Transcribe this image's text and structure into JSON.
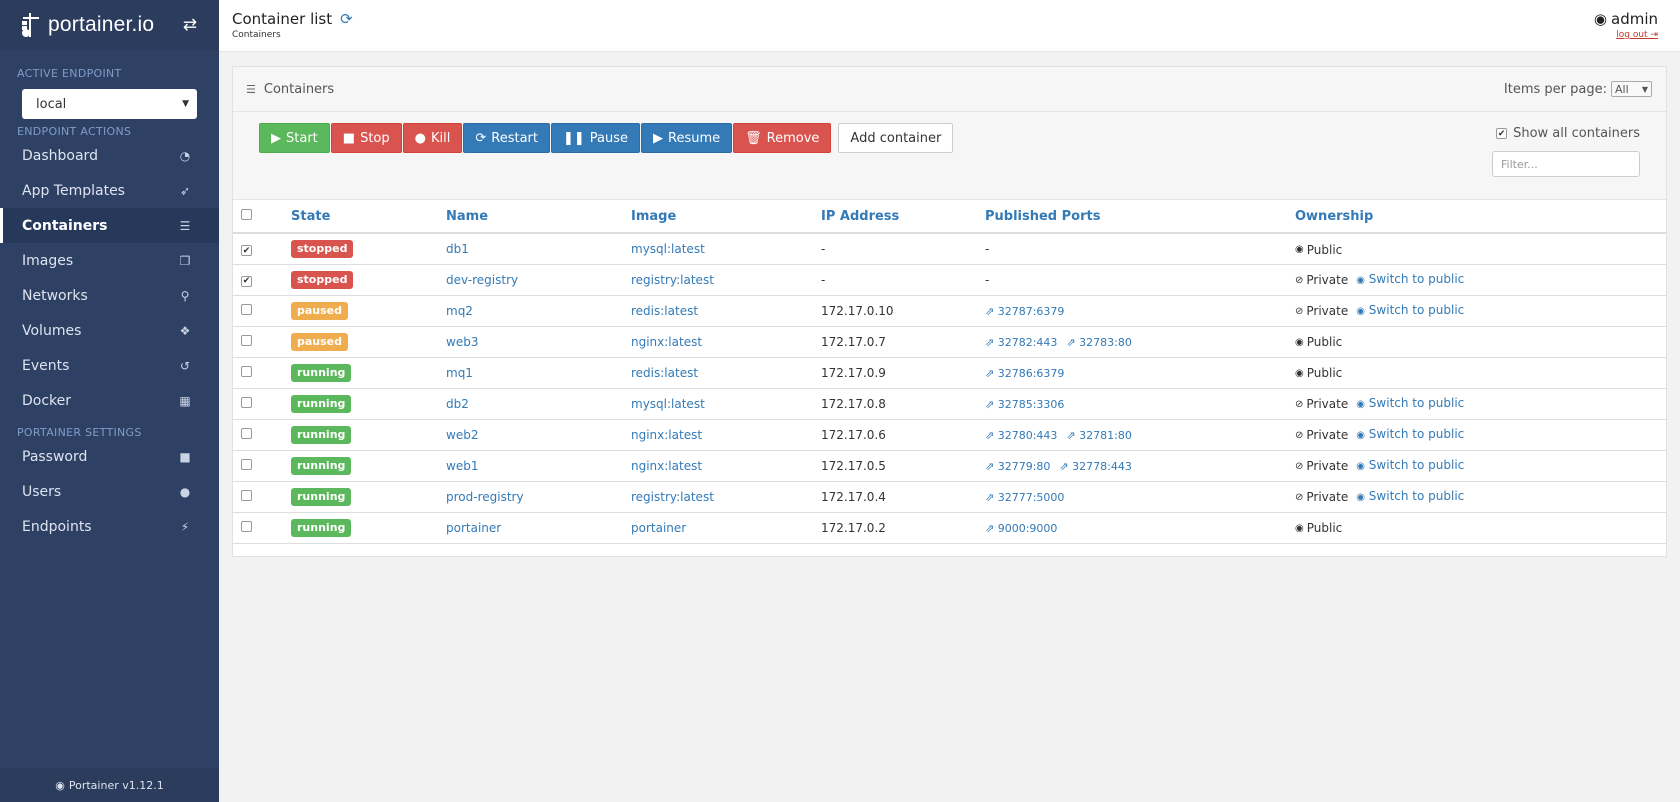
{
  "sidebar": {
    "brand": "portainer.io",
    "active_endpoint_title": "ACTIVE ENDPOINT",
    "endpoint_value": "local",
    "endpoint_actions_title": "ENDPOINT ACTIONS",
    "items": [
      {
        "label": "Dashboard",
        "icon": "tachometer-icon"
      },
      {
        "label": "App Templates",
        "icon": "rocket-icon"
      },
      {
        "label": "Containers",
        "icon": "server-icon"
      },
      {
        "label": "Images",
        "icon": "clone-icon"
      },
      {
        "label": "Networks",
        "icon": "sitemap-icon"
      },
      {
        "label": "Volumes",
        "icon": "cubes-icon"
      },
      {
        "label": "Events",
        "icon": "history-icon"
      },
      {
        "label": "Docker",
        "icon": "th-icon"
      }
    ],
    "settings_title": "PORTAINER SETTINGS",
    "settings_items": [
      {
        "label": "Password",
        "icon": "lock-icon"
      },
      {
        "label": "Users",
        "icon": "user-icon"
      },
      {
        "label": "Endpoints",
        "icon": "plug-icon"
      }
    ],
    "footer": "Portainer v1.12.1"
  },
  "header": {
    "title": "Container list",
    "breadcrumb": "Containers",
    "username": "admin",
    "logout": "log out"
  },
  "panel": {
    "title": "Containers",
    "items_per_page_label": "Items per page:",
    "items_per_page_value": "All",
    "show_all_label": "Show all containers",
    "filter_placeholder": "Filter..."
  },
  "actions": {
    "start": "Start",
    "stop": "Stop",
    "kill": "Kill",
    "restart": "Restart",
    "pause": "Pause",
    "resume": "Resume",
    "remove": "Remove",
    "add": "Add container"
  },
  "table": {
    "columns": [
      "State",
      "Name",
      "Image",
      "IP Address",
      "Published Ports",
      "Ownership"
    ],
    "rows": [
      {
        "checked": true,
        "state": "stopped",
        "name": "db1",
        "image": "mysql:latest",
        "ip": "-",
        "ports": [],
        "ports_text": "-",
        "ownership": "Public",
        "switch": ""
      },
      {
        "checked": true,
        "state": "stopped",
        "name": "dev-registry",
        "image": "registry:latest",
        "ip": "-",
        "ports": [],
        "ports_text": "-",
        "ownership": "Private",
        "switch": "Switch to public"
      },
      {
        "checked": false,
        "state": "paused",
        "name": "mq2",
        "image": "redis:latest",
        "ip": "172.17.0.10",
        "ports": [
          "32787:6379"
        ],
        "ownership": "Private",
        "switch": "Switch to public"
      },
      {
        "checked": false,
        "state": "paused",
        "name": "web3",
        "image": "nginx:latest",
        "ip": "172.17.0.7",
        "ports": [
          "32782:443",
          "32783:80"
        ],
        "ownership": "Public",
        "switch": ""
      },
      {
        "checked": false,
        "state": "running",
        "name": "mq1",
        "image": "redis:latest",
        "ip": "172.17.0.9",
        "ports": [
          "32786:6379"
        ],
        "ownership": "Public",
        "switch": ""
      },
      {
        "checked": false,
        "state": "running",
        "name": "db2",
        "image": "mysql:latest",
        "ip": "172.17.0.8",
        "ports": [
          "32785:3306"
        ],
        "ownership": "Private",
        "switch": "Switch to public"
      },
      {
        "checked": false,
        "state": "running",
        "name": "web2",
        "image": "nginx:latest",
        "ip": "172.17.0.6",
        "ports": [
          "32780:443",
          "32781:80"
        ],
        "ownership": "Private",
        "switch": "Switch to public"
      },
      {
        "checked": false,
        "state": "running",
        "name": "web1",
        "image": "nginx:latest",
        "ip": "172.17.0.5",
        "ports": [
          "32779:80",
          "32778:443"
        ],
        "ownership": "Private",
        "switch": "Switch to public"
      },
      {
        "checked": false,
        "state": "running",
        "name": "prod-registry",
        "image": "registry:latest",
        "ip": "172.17.0.4",
        "ports": [
          "32777:5000"
        ],
        "ownership": "Private",
        "switch": "Switch to public"
      },
      {
        "checked": false,
        "state": "running",
        "name": "portainer",
        "image": "portainer",
        "ip": "172.17.0.2",
        "ports": [
          "9000:9000"
        ],
        "ownership": "Public",
        "switch": ""
      }
    ]
  },
  "colors": {
    "sidebar": "#2e4164",
    "primary": "#337ab7",
    "success": "#5cb85c",
    "danger": "#d9534f",
    "warning": "#f0ad4e"
  }
}
